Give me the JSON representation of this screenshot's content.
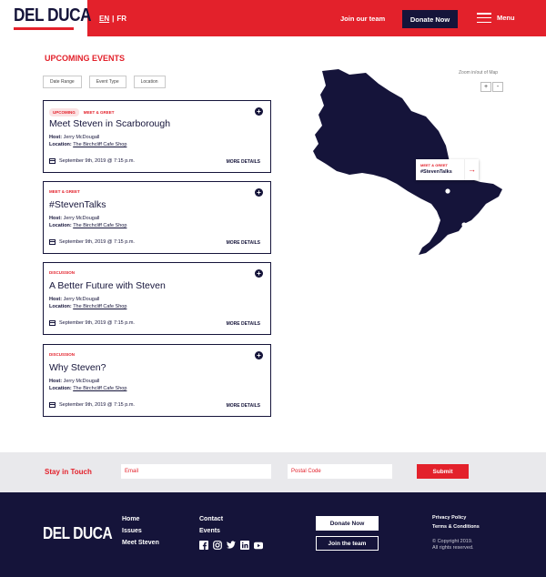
{
  "header": {
    "logo": "DEL DUCA",
    "lang_en": "EN",
    "lang_sep": "|",
    "lang_fr": "FR",
    "join_label": "Join our team",
    "donate_label": "Donate Now",
    "menu_label": "Menu"
  },
  "events": {
    "title": "UPCOMING EVENTS",
    "filters": [
      "Date Range",
      "Event Type",
      "Location"
    ],
    "host_label": "Host:",
    "location_label": "Location:",
    "more_label": "MORE DETAILS",
    "items": [
      {
        "badge": "UPCOMING",
        "tag": "MEET & GREET",
        "title": "Meet Steven in Scarborough",
        "host": "Jerry McDougall",
        "location": "The Birchcliff Cafe Shop",
        "date": "September 9th, 2019 @ 7:15 p.m."
      },
      {
        "badge": "",
        "tag": "MEET & GREET",
        "title": "#StevenTalks",
        "host": "Jerry McDougall",
        "location": "The Birchcliff Cafe Shop",
        "date": "September 9th, 2019 @ 7:15 p.m."
      },
      {
        "badge": "",
        "tag": "DISCUSSION",
        "title": "A Better Future with Steven",
        "host": "Jerry McDougall",
        "location": "The Birchcliff Cafe Shop",
        "date": "September 9th, 2019 @ 7:15 p.m."
      },
      {
        "badge": "",
        "tag": "DISCUSSION",
        "title": "Why Steven?",
        "host": "Jerry McDougall",
        "location": "The Birchcliff Cafe Shop",
        "date": "September 9th, 2019 @ 7:15 p.m."
      }
    ]
  },
  "map": {
    "zoom_label": "Zoom in/out of Map",
    "zoom_in": "+",
    "zoom_out": "-",
    "popup_tag": "MEET & GREET",
    "popup_title": "#StevenTalks",
    "popup_arrow": "→",
    "fill_color": "#15143a"
  },
  "touch": {
    "label": "Stay in Touch",
    "email_placeholder": "Email",
    "postal_placeholder": "Postal Code",
    "submit_label": "Submit"
  },
  "footer": {
    "logo": "DEL DUCA",
    "col1": [
      "Home",
      "Issues",
      "Meet Steven"
    ],
    "col2": [
      "Contact",
      "Events"
    ],
    "donate_label": "Donate Now",
    "join_label": "Join the team",
    "privacy": "Privacy Policy",
    "terms": "Terms & Conditions",
    "copyright_line1": "© Copyright 2019.",
    "copyright_line2": "All rights reserved.",
    "socials": [
      "facebook-icon",
      "instagram-icon",
      "twitter-icon",
      "linkedin-icon",
      "youtube-icon"
    ]
  },
  "colors": {
    "brand_red": "#e3212b",
    "navy": "#15143a"
  }
}
